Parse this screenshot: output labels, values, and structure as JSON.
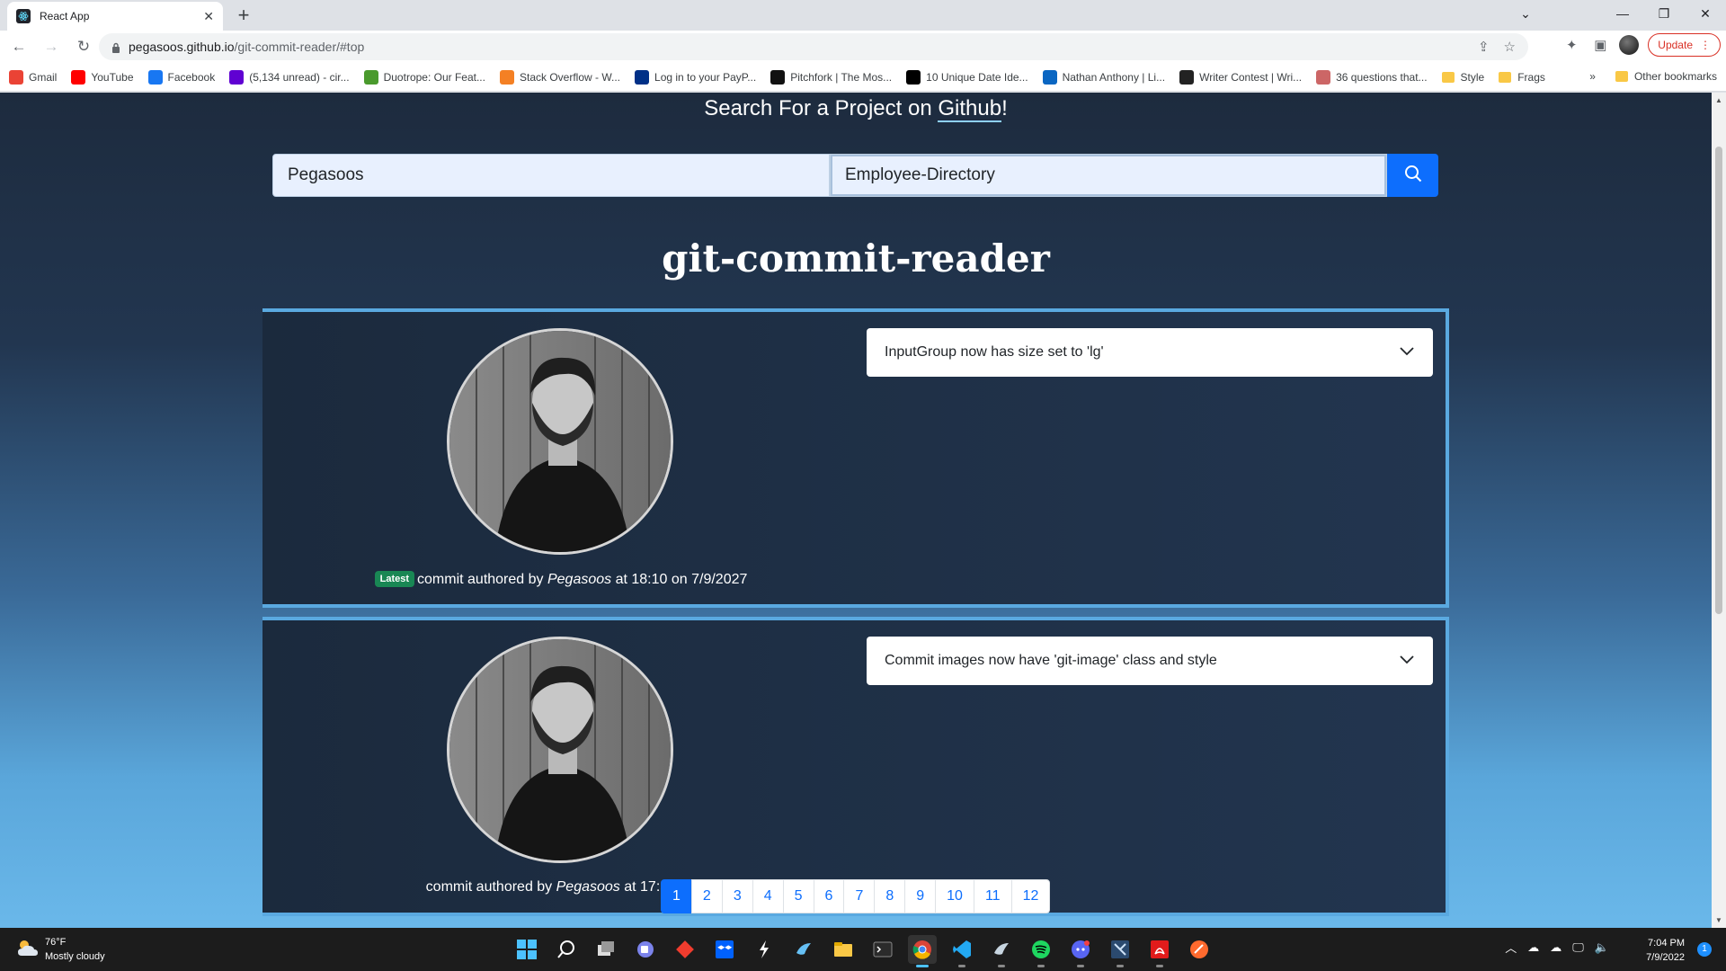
{
  "browser": {
    "tab_title": "React App",
    "url_domain": "pegasoos.github.io",
    "url_path": "/git-commit-reader/#top",
    "update_label": "Update",
    "bookmarks": [
      {
        "label": "Gmail",
        "icon": "gmail-icon",
        "color": "#ea4335"
      },
      {
        "label": "YouTube",
        "icon": "youtube-icon",
        "color": "#ff0000"
      },
      {
        "label": "Facebook",
        "icon": "facebook-icon",
        "color": "#1877f2"
      },
      {
        "label": "(5,134 unread) - cir...",
        "icon": "mail-icon",
        "color": "#6001d2"
      },
      {
        "label": "Duotrope: Our Feat...",
        "icon": "duotrope-icon",
        "color": "#4a9a2d"
      },
      {
        "label": "Stack Overflow - W...",
        "icon": "stackoverflow-icon",
        "color": "#f48024"
      },
      {
        "label": "Log in to your PayP...",
        "icon": "paypal-icon",
        "color": "#003087"
      },
      {
        "label": "Pitchfork | The Mos...",
        "icon": "pitchfork-icon",
        "color": "#111111"
      },
      {
        "label": "10 Unique Date Ide...",
        "icon": "s-icon",
        "color": "#000000"
      },
      {
        "label": "Nathan Anthony | Li...",
        "icon": "linkedin-icon",
        "color": "#0a66c2"
      },
      {
        "label": "Writer Contest | Wri...",
        "icon": "writer-icon",
        "color": "#222222"
      },
      {
        "label": "36 questions that...",
        "icon": "nyt-icon",
        "color": "#cc6666"
      },
      {
        "label": "Style",
        "icon": "folder-icon",
        "color": "#f9c846"
      },
      {
        "label": "Frags",
        "icon": "folder-icon",
        "color": "#f9c846"
      }
    ],
    "more_label": "»",
    "other_bookmarks": "Other bookmarks"
  },
  "page": {
    "heading_prefix": "Search For a Project on ",
    "heading_link": "Github",
    "heading_suffix": "!",
    "owner_value": "Pegasoos",
    "repo_value": "Employee-Directory",
    "repo_title": "git-commit-reader",
    "commits": [
      {
        "message": "InputGroup now has size set to 'lg'",
        "badge": "Latest",
        "meta_prefix": "commit authored by ",
        "author": "Pegasoos",
        "meta_suffix": " at 18:10 on 7/9/2027"
      },
      {
        "message": "Commit images now have 'git-image' class and style",
        "meta_prefix": "commit authored by ",
        "author": "Pegasoos",
        "meta_suffix": " at 17:56 on"
      }
    ],
    "pages": [
      "1",
      "2",
      "3",
      "4",
      "5",
      "6",
      "7",
      "8",
      "9",
      "10",
      "11",
      "12"
    ],
    "active_page": "1"
  },
  "taskbar": {
    "temp": "76°F",
    "weather": "Mostly cloudy",
    "time": "7:04 PM",
    "date": "7/9/2022",
    "notifications": "1"
  }
}
